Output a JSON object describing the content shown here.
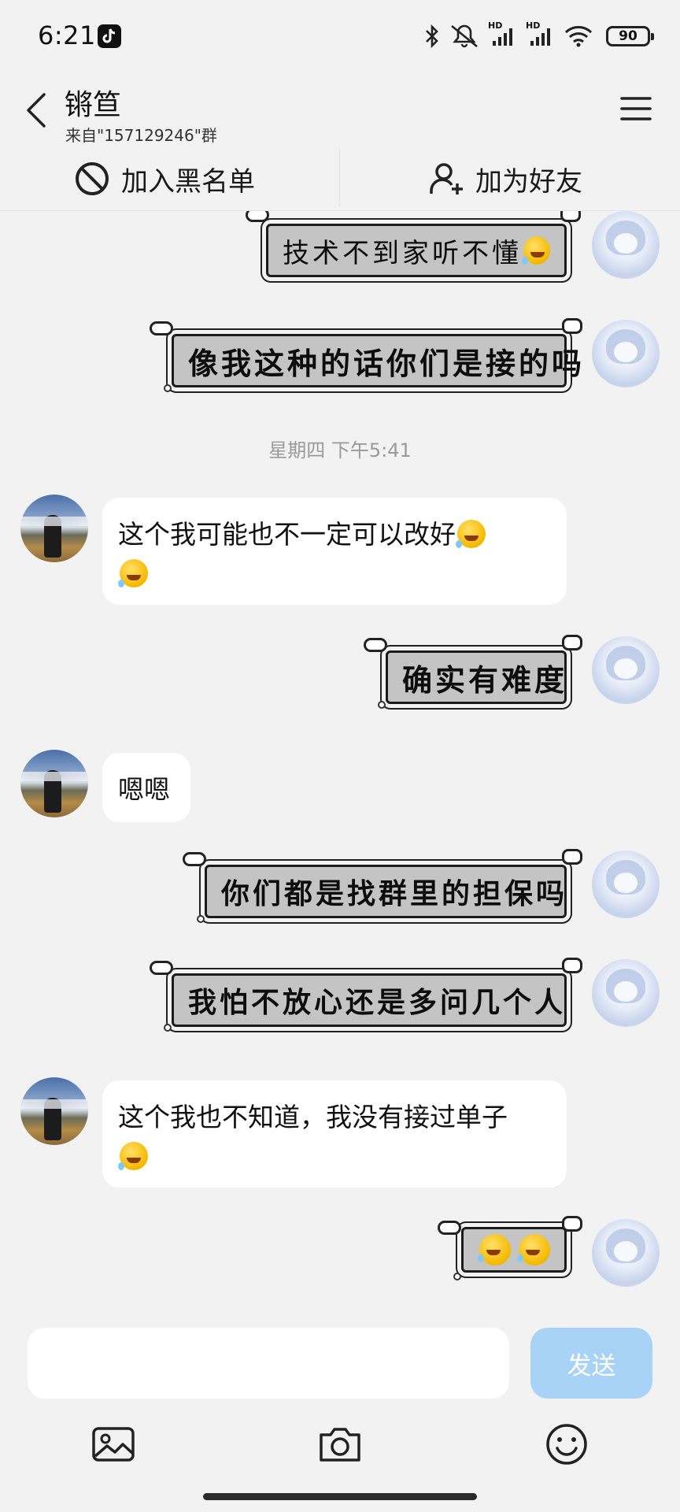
{
  "status_bar": {
    "time": "6:21",
    "battery": "90",
    "net_label_1": "HD",
    "net_label_2": "HD"
  },
  "header": {
    "title": "锵笪",
    "subtitle": "来自\"157129246\"群"
  },
  "actions": {
    "blacklist_label": "加入黑名单",
    "add_friend_label": "加为好友"
  },
  "messages": [
    {
      "side": "right",
      "kind": "sticker",
      "text": "技术不到家听不懂"
    },
    {
      "side": "right",
      "kind": "sticker",
      "text": "像我这种的话你们是接的吗"
    },
    {
      "kind": "time",
      "text": "星期四 下午5:41"
    },
    {
      "side": "left",
      "kind": "text",
      "text": "这个我可能也不一定可以改好"
    },
    {
      "side": "right",
      "kind": "sticker",
      "text": "确实有难度"
    },
    {
      "side": "left",
      "kind": "text",
      "text": "嗯嗯"
    },
    {
      "side": "right",
      "kind": "sticker",
      "text": "你们都是找群里的担保吗"
    },
    {
      "side": "right",
      "kind": "sticker",
      "text": "我怕不放心还是多问几个人"
    },
    {
      "side": "left",
      "kind": "text",
      "text": "这个我也不知道，我没有接过单子"
    },
    {
      "side": "right",
      "kind": "sticker-emoji",
      "text": ""
    }
  ],
  "composer": {
    "input_value": "",
    "input_placeholder": "",
    "send_label": "发送"
  },
  "toolbar_icons": [
    "image-icon",
    "camera-icon",
    "emoji-icon"
  ],
  "colors": {
    "background": "#f2f2f2",
    "bubble": "#ffffff",
    "send_button": "#a9d2f7",
    "sticker_fill": "#c4c4c4",
    "timestamp": "#9a9a9a"
  }
}
